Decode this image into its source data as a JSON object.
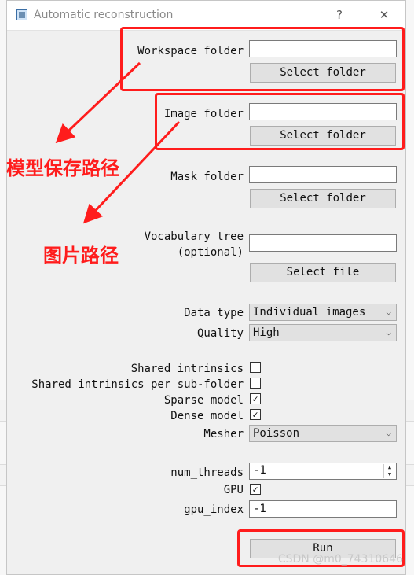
{
  "window": {
    "title": "Automatic reconstruction",
    "help": "?",
    "close": "✕"
  },
  "workspace": {
    "label": "Workspace folder",
    "value": "",
    "button": "Select folder"
  },
  "image": {
    "label": "Image folder",
    "value": "",
    "button": "Select folder"
  },
  "mask": {
    "label": "Mask folder",
    "value": "",
    "button": "Select folder"
  },
  "vocab": {
    "label_line1": "Vocabulary tree",
    "label_line2": "(optional)",
    "value": "",
    "button": "Select file"
  },
  "data_type": {
    "label": "Data type",
    "value": "Individual images"
  },
  "quality": {
    "label": "Quality",
    "value": "High"
  },
  "shared_intrinsics": {
    "label": "Shared intrinsics",
    "checked": false
  },
  "shared_intrinsics_sub": {
    "label": "Shared intrinsics per sub-folder",
    "checked": false
  },
  "sparse_model": {
    "label": "Sparse model",
    "checked": true
  },
  "dense_model": {
    "label": "Dense model",
    "checked": true
  },
  "mesher": {
    "label": "Mesher",
    "value": "Poisson"
  },
  "num_threads": {
    "label": "num_threads",
    "value": "-1"
  },
  "gpu": {
    "label": "GPU",
    "checked": true
  },
  "gpu_index": {
    "label": "gpu_index",
    "value": "-1"
  },
  "run": {
    "label": "Run"
  },
  "annotations": {
    "model_path": "模型保存路径",
    "image_path": "图片路径"
  },
  "watermark": "CSDN @m0_74310646",
  "glyphs": {
    "check": "✓",
    "arrow_down": "⌵",
    "spin_up": "▲",
    "spin_down": "▼"
  },
  "colors": {
    "annotation_red": "#ff1c1c",
    "window_bg": "#f0f0f0"
  }
}
